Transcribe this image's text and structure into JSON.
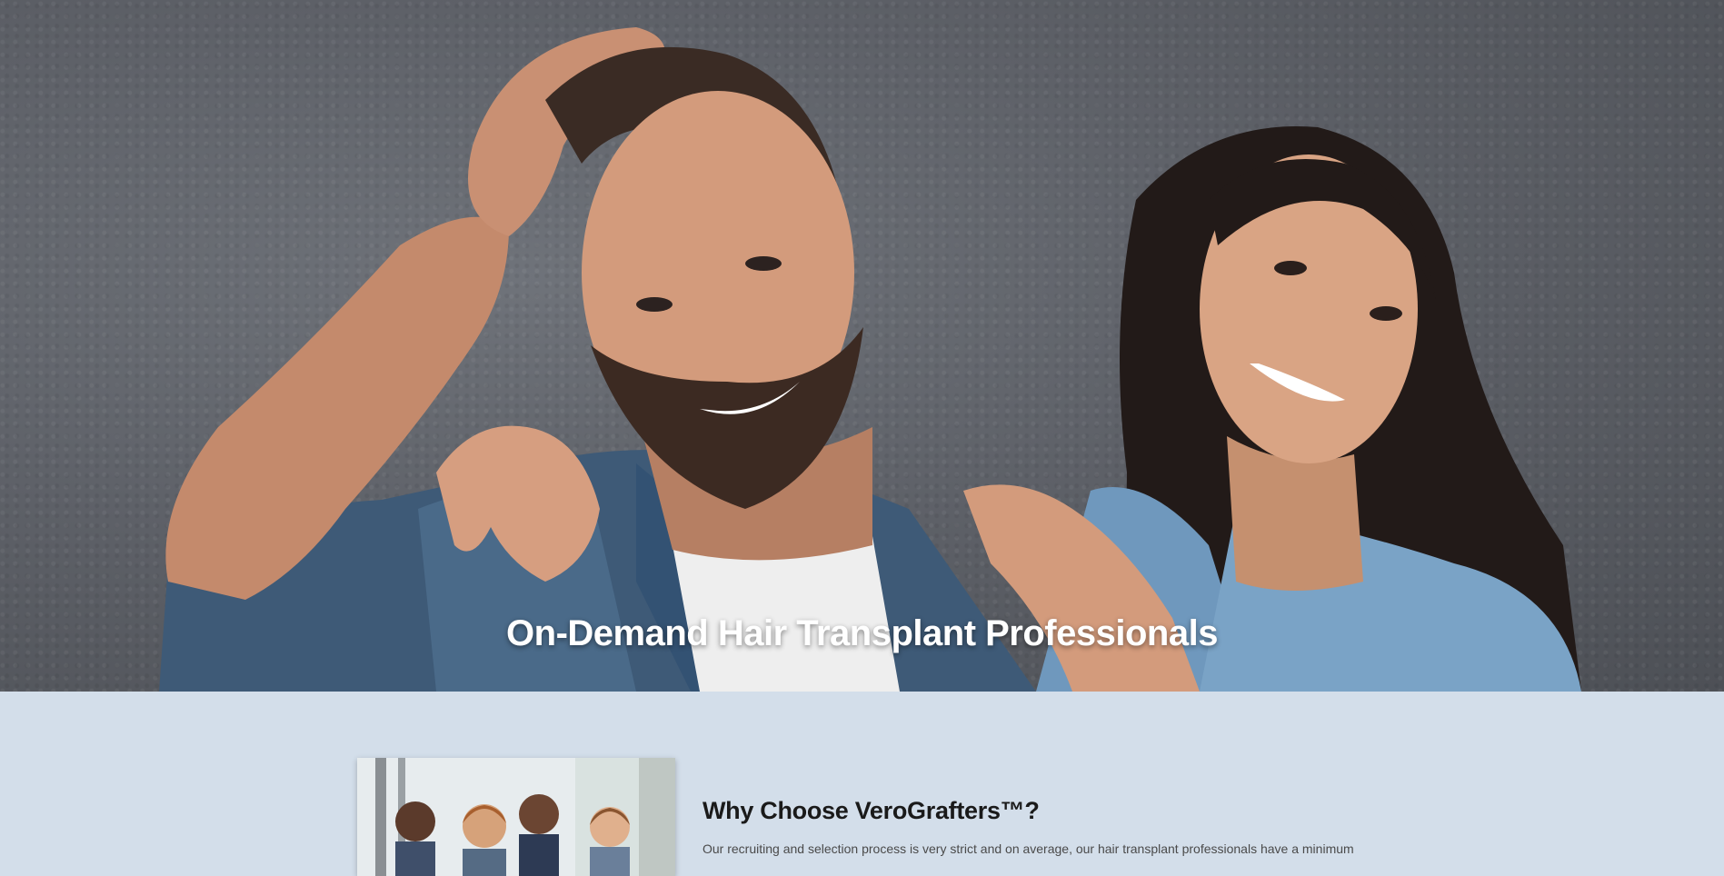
{
  "hero": {
    "title": "On-Demand Hair Transplant Professionals",
    "image_alt": "Smiling bearded man with hand in hair and smiling woman with long dark hair, both wearing denim shirts"
  },
  "why_section": {
    "title": "Why Choose VeroGrafters™?",
    "text": "Our recruiting and selection process is very strict and on average, our hair transplant professionals have a minimum",
    "image_alt": "Team of smiling hair transplant professionals"
  },
  "colors": {
    "section_bg": "#d3deea",
    "hero_bg": "#5e6168",
    "title_text": "#1a1a1a",
    "body_text": "#4a4a4a"
  }
}
